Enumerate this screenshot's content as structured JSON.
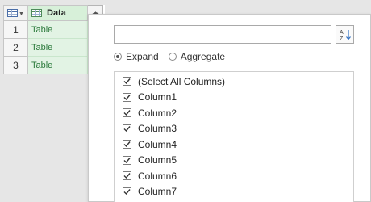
{
  "grid": {
    "column_header": "Data",
    "rows": [
      {
        "num": "1",
        "value": "Table"
      },
      {
        "num": "2",
        "value": "Table"
      },
      {
        "num": "3",
        "value": "Table"
      }
    ],
    "expand_icon": "expand-columns-icon",
    "header_color": "#d7f0d9",
    "cell_text_color": "#2b7a3b"
  },
  "panel": {
    "search": {
      "value": "",
      "placeholder": ""
    },
    "sort_icon": "sort-az-icon",
    "options": [
      {
        "label": "Expand",
        "selected": true
      },
      {
        "label": "Aggregate",
        "selected": false
      }
    ],
    "columns": [
      {
        "label": "(Select All Columns)",
        "checked": true
      },
      {
        "label": "Column1",
        "checked": true
      },
      {
        "label": "Column2",
        "checked": true
      },
      {
        "label": "Column3",
        "checked": true
      },
      {
        "label": "Column4",
        "checked": true
      },
      {
        "label": "Column5",
        "checked": true
      },
      {
        "label": "Column6",
        "checked": true
      },
      {
        "label": "Column7",
        "checked": true
      }
    ]
  }
}
